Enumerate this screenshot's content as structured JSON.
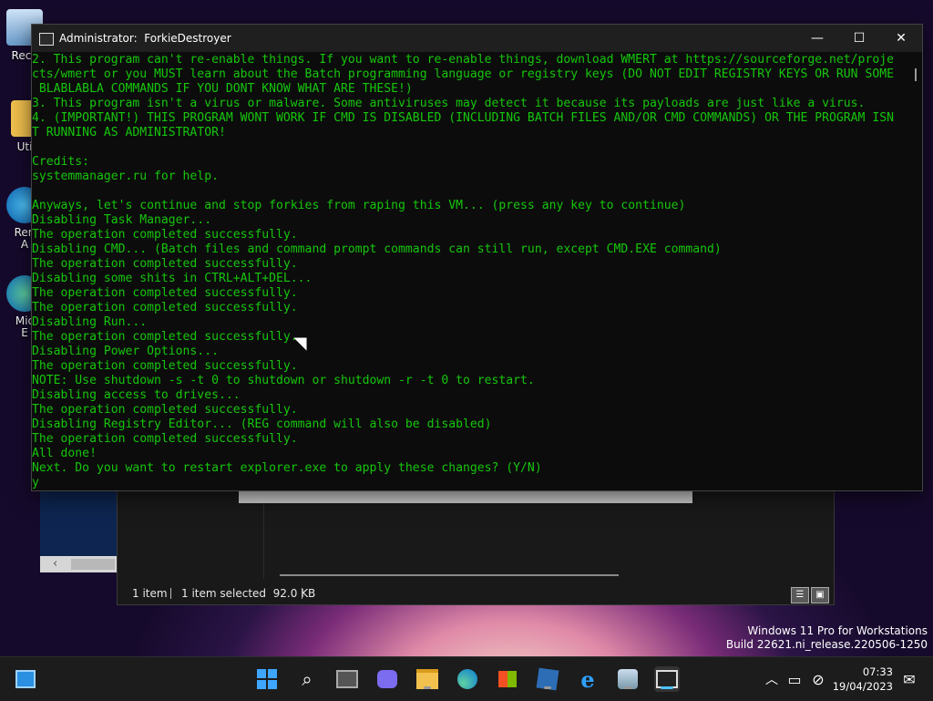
{
  "desktop": {
    "icons": [
      {
        "label": "Recy",
        "icon": "recycle-bin-icon"
      },
      {
        "label": "Uti",
        "icon": "folder-icon"
      },
      {
        "label": "Ren\nA",
        "icon": "app-icon"
      },
      {
        "label": "Mic\nE",
        "icon": "edge-shortcut-icon"
      }
    ]
  },
  "console": {
    "title": "Administrator:  ForkieDestroyer",
    "buttons": {
      "minimize": "—",
      "maximize": "☐",
      "close": "✕"
    },
    "lines": [
      "2. This program can't re-enable things. If you want to re-enable things, download WMERT at https://sourceforge.net/proje",
      "cts/wmert or you MUST learn about the Batch programming language or registry keys (DO NOT EDIT REGISTRY KEYS OR RUN SOME",
      " BLABLABLA COMMANDS IF YOU DONT KNOW WHAT ARE THESE!)",
      "3. This program isn't a virus or malware. Some antiviruses may detect it because its payloads are just like a virus.",
      "4. (IMPORTANT!) THIS PROGRAM WONT WORK IF CMD IS DISABLED (INCLUDING BATCH FILES AND/OR CMD COMMANDS) OR THE PROGRAM ISN",
      "T RUNNING AS ADMINISTRATOR!",
      "",
      "Credits:",
      "systemmanager.ru for help.",
      "",
      "Anyways, let's continue and stop forkies from raping this VM... (press any key to continue)",
      "Disabling Task Manager...",
      "The operation completed successfully.",
      "Disabling CMD... (Batch files and command prompt commands can still run, except CMD.EXE command)",
      "The operation completed successfully.",
      "Disabling some shits in CTRL+ALT+DEL...",
      "The operation completed successfully.",
      "The operation completed successfully.",
      "Disabling Run...",
      "The operation completed successfully.",
      "Disabling Power Options...",
      "The operation completed successfully.",
      "NOTE: Use shutdown -s -t 0 to shutdown or shutdown -r -t 0 to restart.",
      "Disabling access to drives...",
      "The operation completed successfully.",
      "Disabling Registry Editor... (REG command will also be disabled)",
      "The operation completed successfully.",
      "All done!",
      "Next. Do you want to restart explorer.exe to apply these changes? (Y/N)",
      "y"
    ],
    "text_color": "#16c60c",
    "bg_color": "#0c0c0c"
  },
  "explorer": {
    "status_items": "1 item",
    "status_selected": "1 item selected  92.0 KB"
  },
  "watermark": {
    "line1": "Windows 11 Pro for Workstations",
    "line2": "Build 22621.ni_release.220506-1250"
  },
  "taskbar": {
    "icons": [
      "widgets-icon",
      "start-icon",
      "search-icon",
      "task-view-icon",
      "chat-icon",
      "file-explorer-icon",
      "edge-icon",
      "store-icon",
      "app-icon",
      "internet-explorer-icon",
      "control-panel-icon",
      "console-icon"
    ],
    "clock_time": "07:33",
    "clock_date": "19/04/2023"
  }
}
